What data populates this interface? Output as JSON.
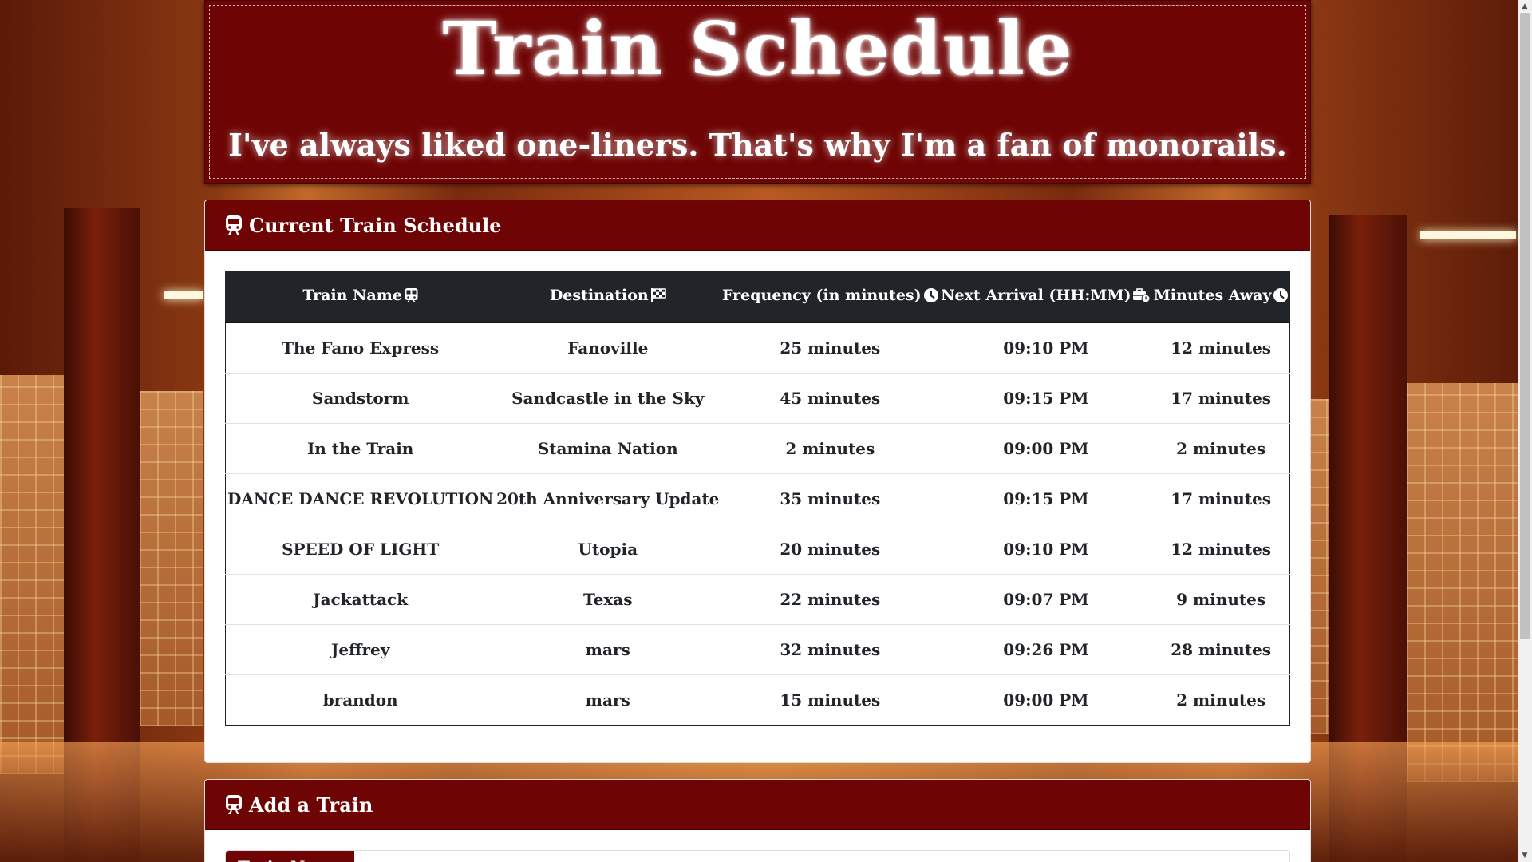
{
  "header": {
    "title": "Train Schedule",
    "subtitle": "I've always liked one-liners. That's why I'm a fan of monorails."
  },
  "schedule_panel": {
    "title": "Current Train Schedule",
    "icon": "train-icon",
    "columns": [
      {
        "label": "Train Name",
        "icon": "subway-icon"
      },
      {
        "label": "Destination",
        "icon": "flag-checkered-icon"
      },
      {
        "label": "Frequency (in minutes)",
        "icon": "clock-icon"
      },
      {
        "label": "Next Arrival (HH:MM)",
        "icon": "business-time-icon"
      },
      {
        "label": "Minutes Away",
        "icon": "clock-icon"
      }
    ],
    "rows": [
      [
        "The Fano Express",
        "Fanoville",
        "25 minutes",
        "09:10 PM",
        "12 minutes"
      ],
      [
        "Sandstorm",
        "Sandcastle in the Sky",
        "45 minutes",
        "09:15 PM",
        "17 minutes"
      ],
      [
        "In the Train",
        "Stamina Nation",
        "2 minutes",
        "09:00 PM",
        "2 minutes"
      ],
      [
        "DANCE DANCE REVOLUTION",
        "20th Anniversary Update",
        "35 minutes",
        "09:15 PM",
        "17 minutes"
      ],
      [
        "SPEED OF LIGHT",
        "Utopia",
        "20 minutes",
        "09:10 PM",
        "12 minutes"
      ],
      [
        "Jackattack",
        "Texas",
        "22 minutes",
        "09:07 PM",
        "9 minutes"
      ],
      [
        "Jeffrey",
        "mars",
        "32 minutes",
        "09:26 PM",
        "28 minutes"
      ],
      [
        "brandon",
        "mars",
        "15 minutes",
        "09:00 PM",
        "2 minutes"
      ]
    ]
  },
  "add_panel": {
    "title": "Add a Train",
    "icon": "train-icon",
    "train_name_label": "Train Name"
  },
  "colors": {
    "brand_red": "#6e0404",
    "table_header": "#212529"
  }
}
